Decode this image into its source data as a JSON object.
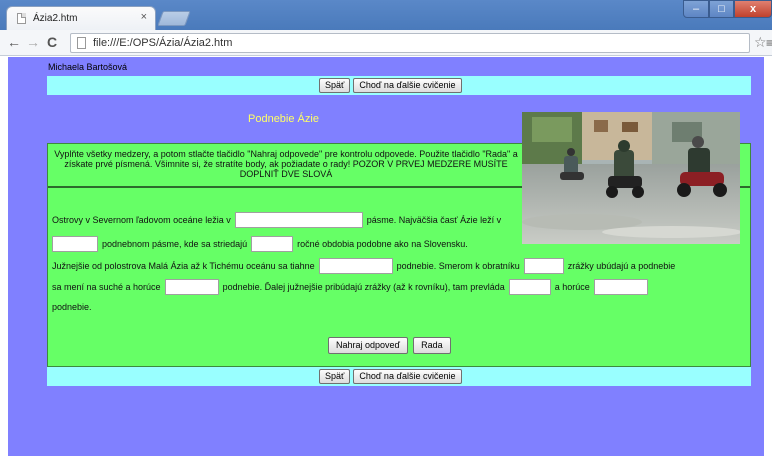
{
  "browser": {
    "tab_title": "Ázia2.htm",
    "tab_close": "×",
    "url": "file:///E:/OPS/Ázia/Ázia2.htm",
    "window_controls": [
      "–",
      "□",
      "x"
    ]
  },
  "page": {
    "author": "Michaela Bartošová",
    "nav": {
      "back_label": "Späť",
      "next_label": "Choď na ďalšie cvičenie"
    },
    "heading": "Podnebie Ázie",
    "photo_description": "flooded-street-motorcycles",
    "instructions": "Vyplňte všetky medzery, a potom stlačte tlačidlo \"Nahraj odpovede\" pre kontrolu odpovede. Použite tlačidlo \"Rada\" a získate prvé písmená. Všimnite si, že stratíte body, ak požiadate o rady! POZOR V PRVEJ MEDZERE MUSÍTE DOPLNIŤ DVE SLOVÁ",
    "exercise": {
      "line1_a": "Ostrovy v Severnom ľadovom oceáne ležia v",
      "line1_b": "pásme. Najväčšia časť Ázie leží v",
      "line2_a": "podnebnom pásme, kde sa striedajú",
      "line2_b": "ročné obdobia podobne ako na Slovensku.",
      "line3_a": "Južnejšie od polostrova Malá Ázia až k Tichému oceánu sa tiahne",
      "line3_b": "podnebie. Smerom k obratníku",
      "line3_c": "zrážky ubúdajú a podnebie",
      "line4_a": "sa mení na suché a horúce",
      "line4_b": "podnebie. Ďalej južnejšie pribúdajú zrážky (až k rovníku), tam prevláda",
      "line4_c": "a horúce",
      "line5": "podnebie.",
      "fields": [
        "",
        "",
        "",
        "",
        "",
        "",
        "",
        ""
      ]
    },
    "check_label": "Nahraj odpoveď",
    "hint_label": "Rada"
  },
  "colors": {
    "page_bg": "#8080ff",
    "nav_bar": "#99ffff",
    "exercise_bg": "#66ff66",
    "heading": "#ffff66"
  }
}
